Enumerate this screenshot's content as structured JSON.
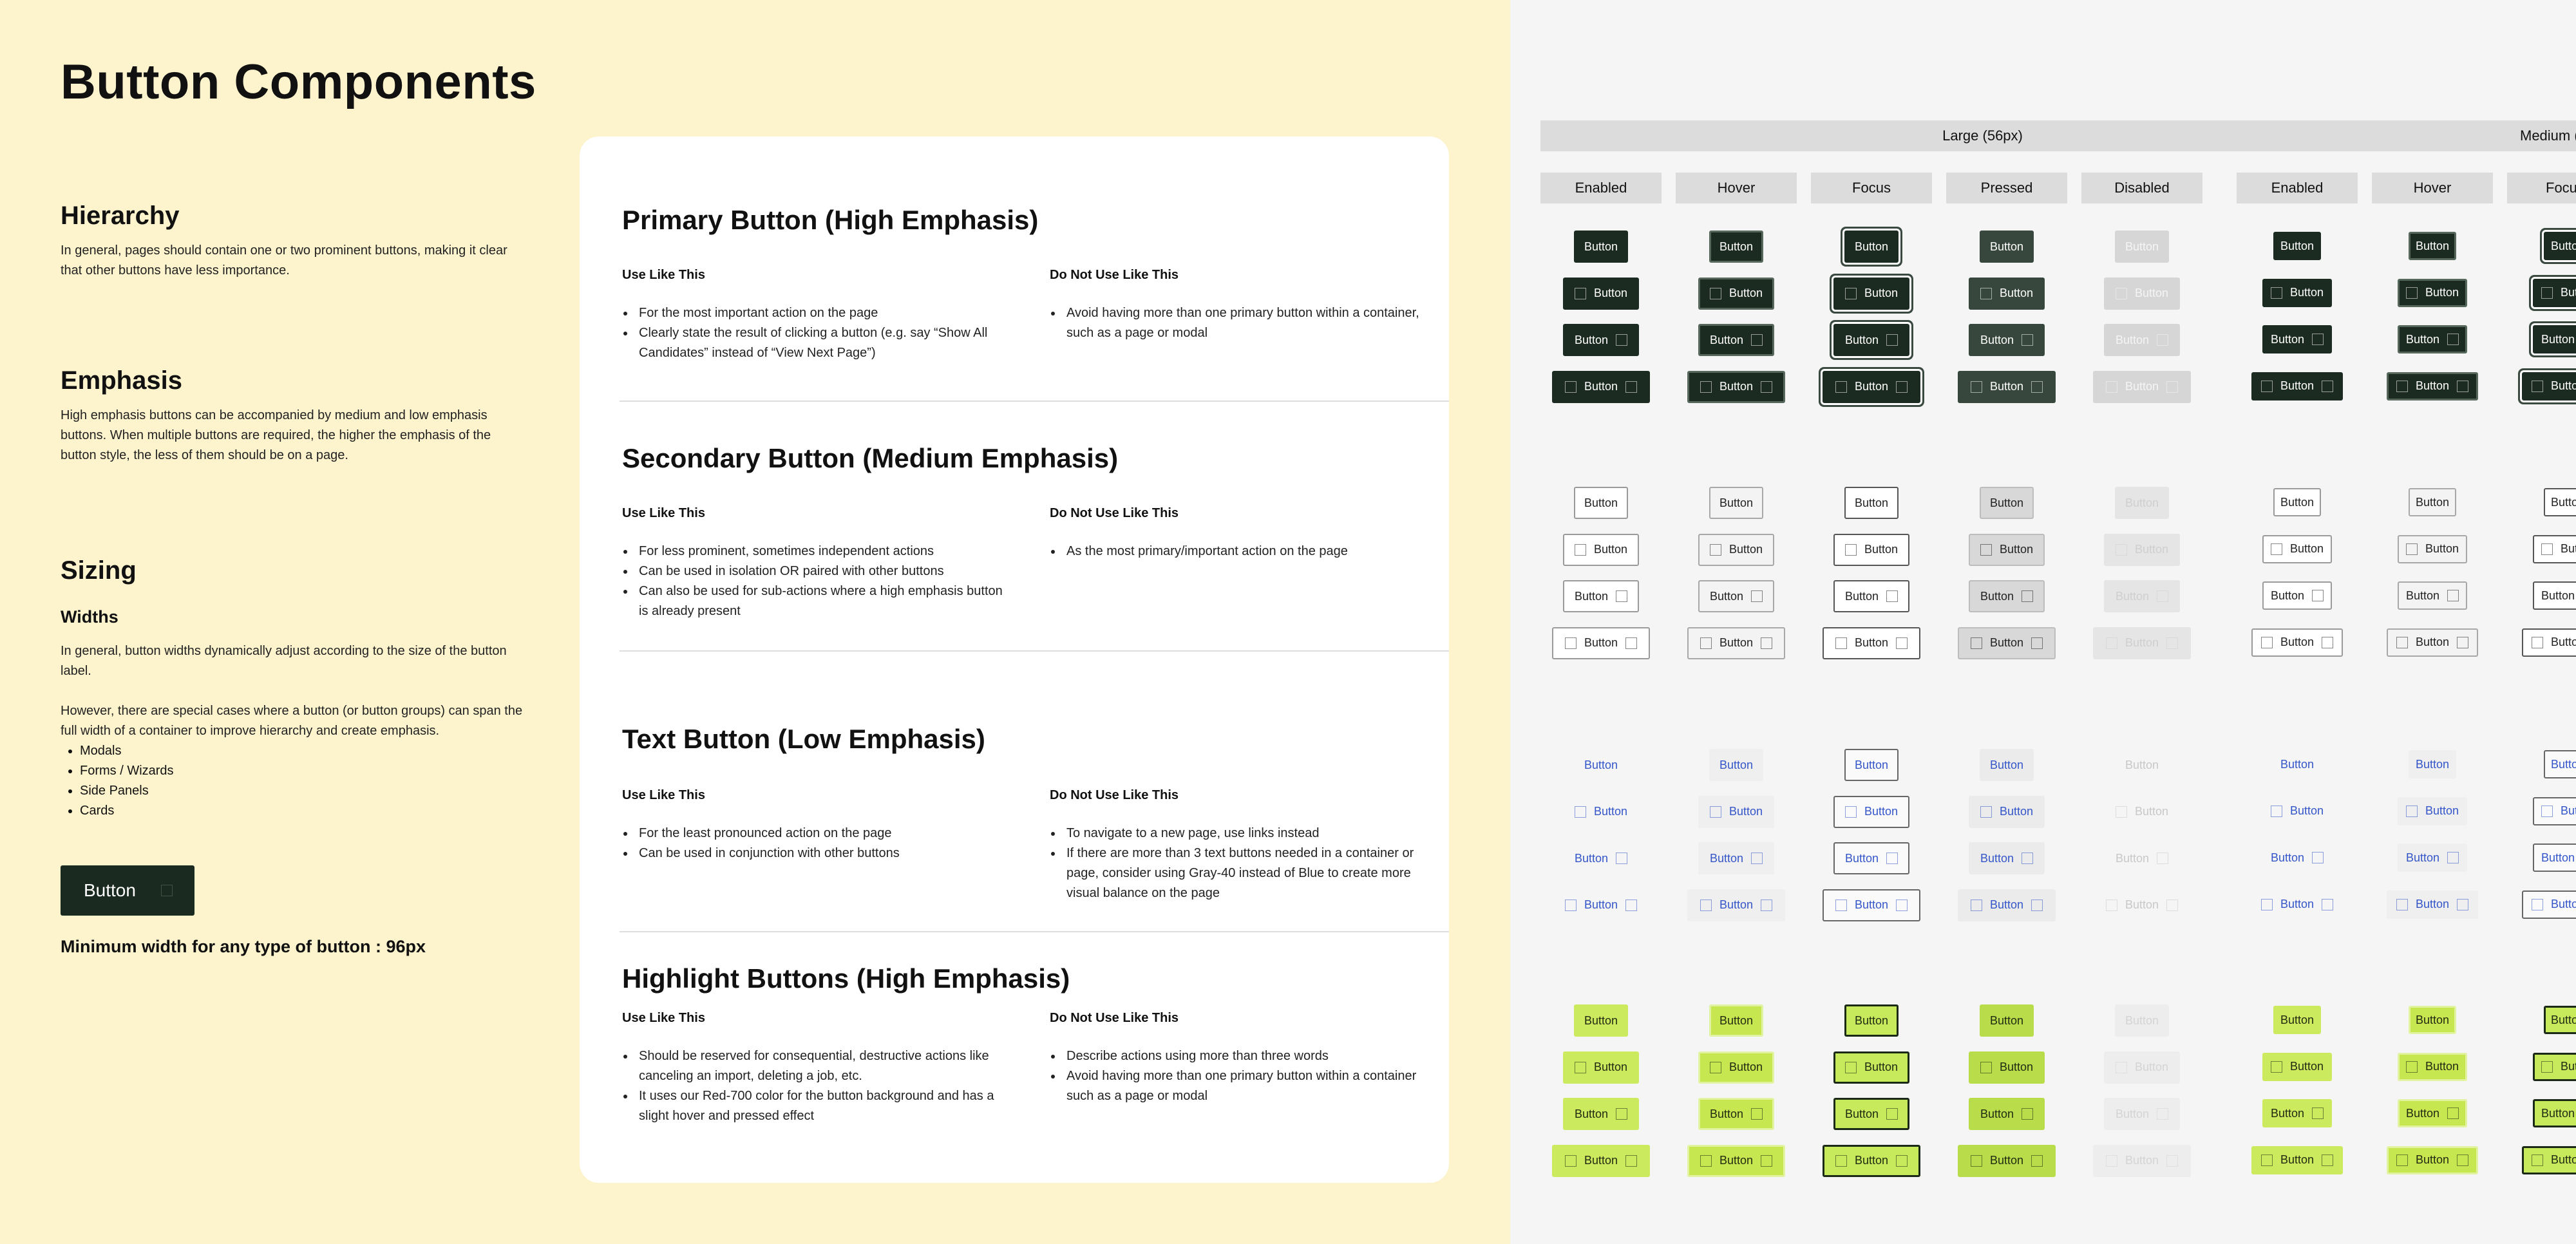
{
  "page": {
    "title": "Button Components"
  },
  "sidebar": {
    "hierarchy": {
      "heading": "Hierarchy",
      "text": "In general, pages should contain one or two prominent buttons, making it clear that other buttons have less importance."
    },
    "emphasis": {
      "heading": "Emphasis",
      "text": "High emphasis buttons can be accompanied by medium and low emphasis buttons. When multiple buttons are required, the higher the emphasis of the button style, the less of them should be on a page."
    },
    "sizing": {
      "heading": "Sizing",
      "subheading": "Widths",
      "text1": "In general, button widths dynamically adjust according to the size of the button label.",
      "text2": "However, there are special cases where a button (or button groups) can span the full width of a container to improve hierarchy and create emphasis.",
      "items": [
        "Modals",
        "Forms / Wizards",
        "Side Panels",
        "Cards"
      ],
      "demo_button": "Button",
      "min_width_note": "Minimum width for any type of button : 96px"
    }
  },
  "sections": [
    {
      "title": "Primary Button (High Emphasis)",
      "use_label": "Use Like This",
      "use_items": [
        "For the most important action on the page",
        "Clearly state the result of clicking a button (e.g. say “Show All Candidates” instead of “View Next Page”)"
      ],
      "dont_label": "Do Not Use Like This",
      "dont_items": [
        "Avoid having more than one primary button within a container, such as a page or modal"
      ]
    },
    {
      "title": "Secondary Button (Medium Emphasis)",
      "use_label": "Use Like This",
      "use_items": [
        "For less prominent, sometimes independent actions",
        "Can be used in isolation OR paired with other buttons",
        "Can also be used for sub-actions where a high emphasis button is already present"
      ],
      "dont_label": "Do Not Use Like This",
      "dont_items": [
        "As the most primary/important action on the page"
      ]
    },
    {
      "title": "Text Button (Low Emphasis)",
      "use_label": "Use Like This",
      "use_items": [
        "For the least pronounced action on the page",
        "Can be used in conjunction with other buttons"
      ],
      "dont_label": "Do Not Use Like This",
      "dont_items": [
        "To navigate to a new page, use links instead",
        "If there are more than 3 text buttons needed in a container or page, consider using Gray-40 instead of Blue to create more visual balance on the page"
      ]
    },
    {
      "title": "Highlight Buttons (High Emphasis)",
      "use_label": "Use Like This",
      "use_items": [
        "Should be reserved for consequential, destructive actions like canceling an import, deleting a job, etc.",
        "It uses our Red-700 color for the button background and has a slight hover and pressed effect"
      ],
      "dont_label": "Do Not Use Like This",
      "dont_items": [
        "Describe actions using more than three words",
        "Avoid having more than one primary button within a container such as a page or modal"
      ]
    }
  ],
  "grid": {
    "groups": [
      "Large (56px)",
      "Medium ("
    ],
    "states": [
      "Enabled",
      "Hover",
      "Focus",
      "Pressed",
      "Disabled"
    ],
    "medium_states": [
      "Enabled",
      "Hover",
      "Focu"
    ],
    "button_label": "Button"
  }
}
